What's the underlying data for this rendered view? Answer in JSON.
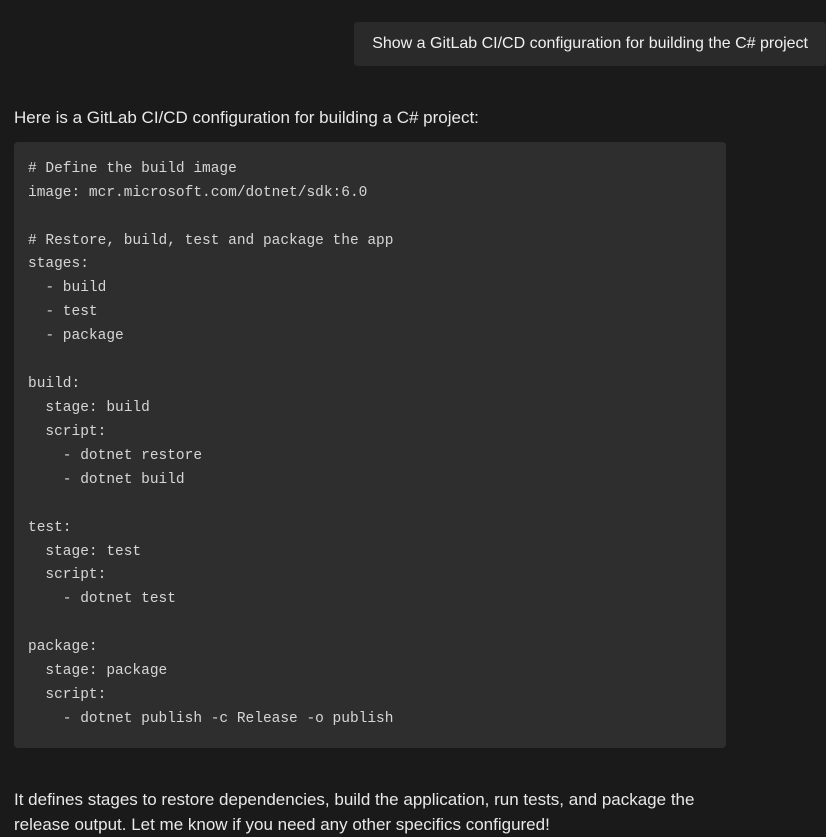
{
  "conversation": {
    "user_message": "Show a GitLab CI/CD configuration for building the C# project",
    "assistant_intro": "Here is a GitLab CI/CD configuration for building a C# project:",
    "code_block": "# Define the build image\nimage: mcr.microsoft.com/dotnet/sdk:6.0\n\n# Restore, build, test and package the app\nstages:\n  - build\n  - test\n  - package\n\nbuild:\n  stage: build\n  script:\n    - dotnet restore\n    - dotnet build\n\ntest:\n  stage: test\n  script:\n    - dotnet test\n\npackage:\n  stage: package\n  script:\n    - dotnet publish -c Release -o publish",
    "assistant_outro": "It defines stages to restore dependencies, build the application, run tests, and package the release output. Let me know if you need any other specifics configured!"
  }
}
